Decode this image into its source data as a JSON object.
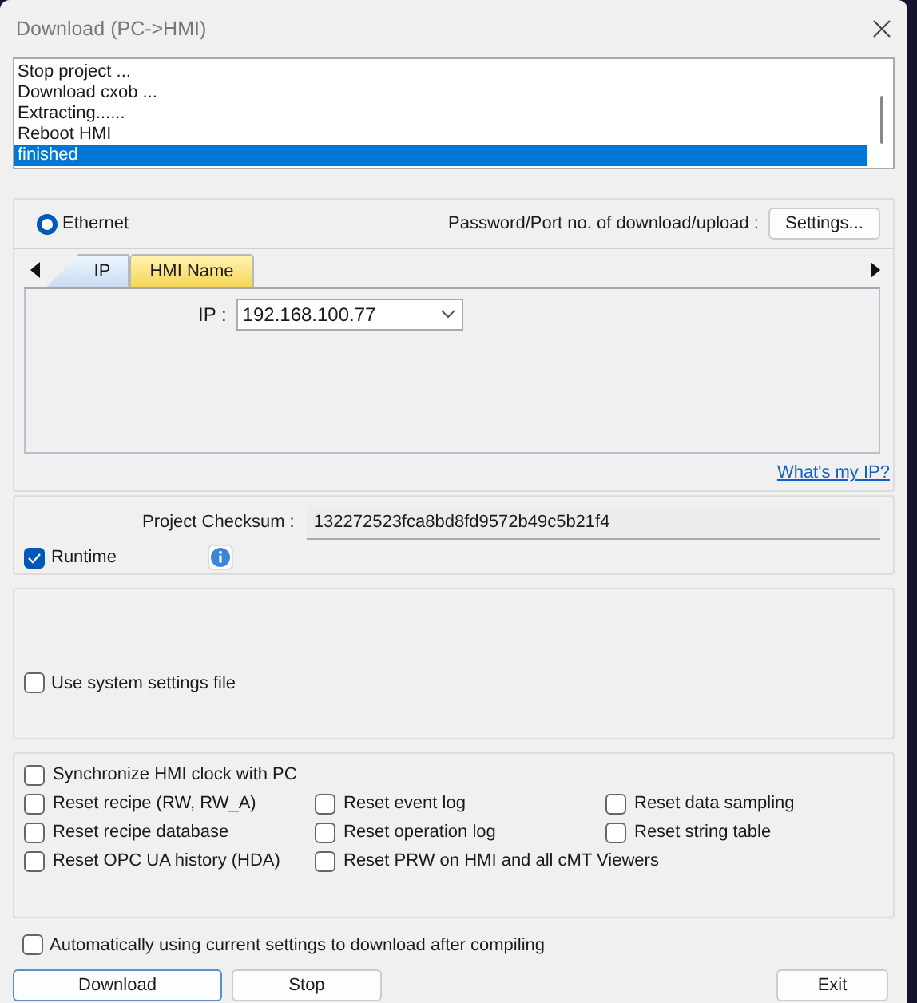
{
  "window": {
    "title": "Download (PC->HMI)"
  },
  "log": [
    {
      "text": "Stop project ...",
      "selected": false
    },
    {
      "text": "Download cxob ...",
      "selected": false
    },
    {
      "text": "Extracting......",
      "selected": false
    },
    {
      "text": "Reboot HMI",
      "selected": false
    },
    {
      "text": "finished",
      "selected": true
    }
  ],
  "connection": {
    "option": {
      "label": "Ethernet",
      "selected": true
    },
    "password_label": "Password/Port no. of download/upload :",
    "settings_button": "Settings...",
    "tabs": [
      {
        "label": "IP",
        "selected": true
      },
      {
        "label": "HMI Name",
        "selected": false
      }
    ],
    "ip_label": "IP :",
    "ip_value": "192.168.100.77",
    "link": "What's my IP?"
  },
  "checksum": {
    "label": "Project Checksum :",
    "value": "132272523fca8bd8fd9572b49c5b21f4"
  },
  "runtime": {
    "label": "Runtime",
    "checked": true
  },
  "system_settings": {
    "label": "Use system settings file",
    "checked": false
  },
  "sync_clock": {
    "label": "Synchronize HMI clock with PC",
    "checked": false
  },
  "reset_options": [
    {
      "label": "Reset recipe (RW, RW_A)",
      "checked": false
    },
    {
      "label": "Reset event log",
      "checked": false
    },
    {
      "label": "Reset data sampling",
      "checked": false
    },
    {
      "label": "Reset recipe database",
      "checked": false
    },
    {
      "label": "Reset operation log",
      "checked": false
    },
    {
      "label": "Reset string table",
      "checked": false
    },
    {
      "label": "Reset OPC UA history (HDA)",
      "checked": false
    },
    {
      "label": "Reset PRW on HMI and all cMT Viewers",
      "checked": false
    }
  ],
  "auto_download": {
    "label": "Automatically using current settings to download after compiling",
    "checked": false
  },
  "buttons": [
    {
      "label": "Download",
      "kind": "default"
    },
    {
      "label": "Stop",
      "kind": "normal"
    },
    {
      "label": "Exit",
      "kind": "normal"
    }
  ]
}
